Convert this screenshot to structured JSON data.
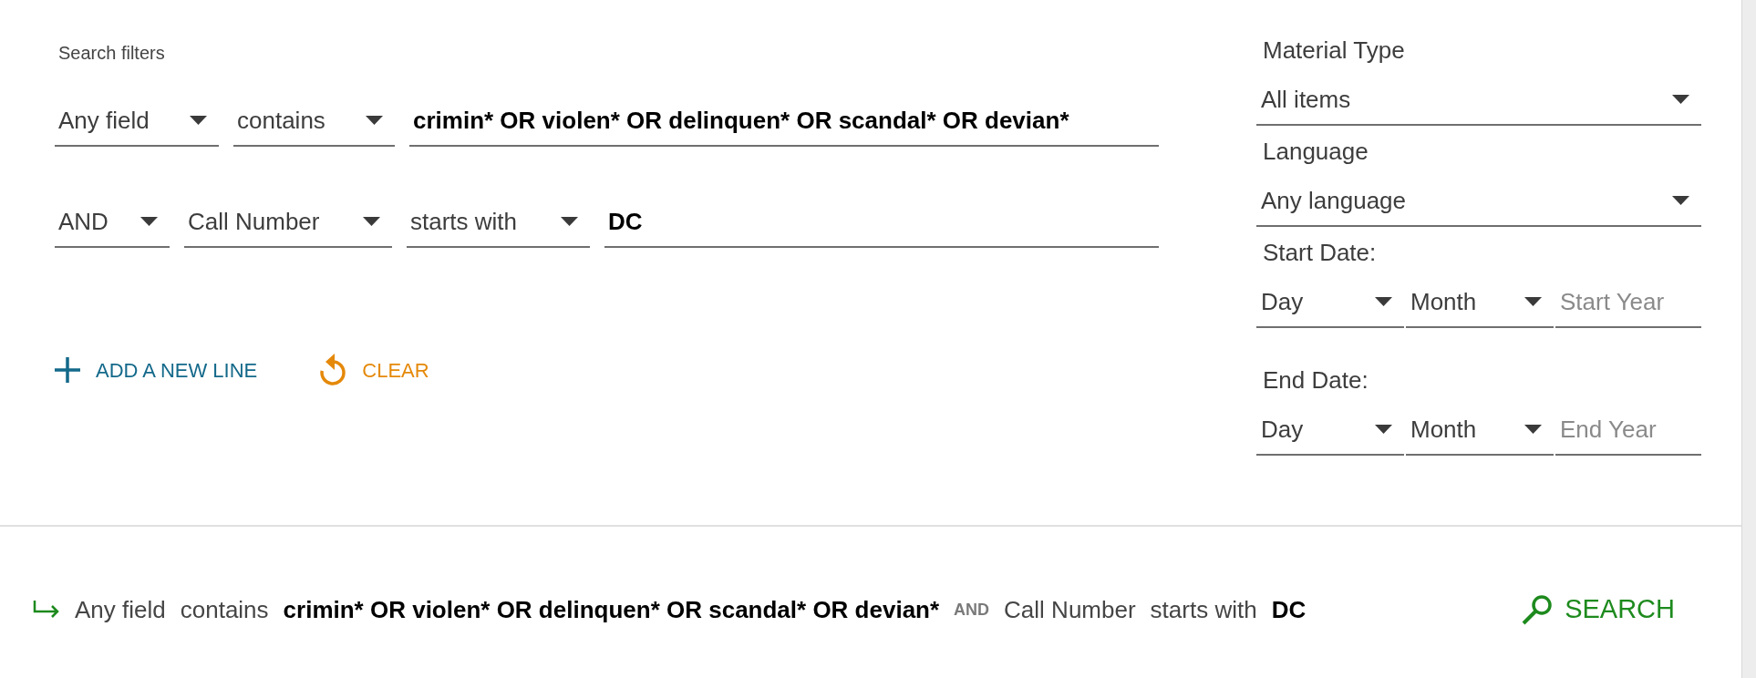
{
  "filters": {
    "heading": "Search filters",
    "rows": [
      {
        "controls": [
          {
            "kind": "select",
            "value": "Any field"
          },
          {
            "kind": "select",
            "value": "contains"
          },
          {
            "kind": "input",
            "value": "crimin* OR violen* OR delinquen* OR scandal* OR devian*"
          }
        ]
      },
      {
        "controls": [
          {
            "kind": "select",
            "value": "AND"
          },
          {
            "kind": "select",
            "value": "Call Number"
          },
          {
            "kind": "select",
            "value": "starts with"
          },
          {
            "kind": "input",
            "value": "DC"
          }
        ]
      }
    ],
    "actions": [
      {
        "kind": "add",
        "label": "ADD A NEW LINE"
      },
      {
        "kind": "clear",
        "label": "CLEAR"
      }
    ]
  },
  "facets": [
    {
      "kind": "select",
      "label": "Material Type",
      "value": "All items"
    },
    {
      "kind": "select",
      "label": "Language",
      "value": "Any language"
    },
    {
      "kind": "date",
      "label": "Start Date:",
      "day": "Day",
      "month": "Month",
      "year_placeholder": "Start Year"
    },
    {
      "kind": "date",
      "label": "End Date:",
      "day": "Day",
      "month": "Month",
      "year_placeholder": "End Year"
    }
  ],
  "summary": {
    "parts": [
      {
        "kind": "field",
        "text": "Any field"
      },
      {
        "kind": "operator",
        "text": "contains"
      },
      {
        "kind": "term",
        "text": "crimin* OR violen* OR delinquen* OR scandal* OR devian*"
      },
      {
        "kind": "boolean",
        "text": "AND"
      },
      {
        "kind": "field",
        "text": "Call Number"
      },
      {
        "kind": "operator",
        "text": "starts with"
      },
      {
        "kind": "term",
        "text": "DC"
      }
    ],
    "search_button": "SEARCH"
  }
}
